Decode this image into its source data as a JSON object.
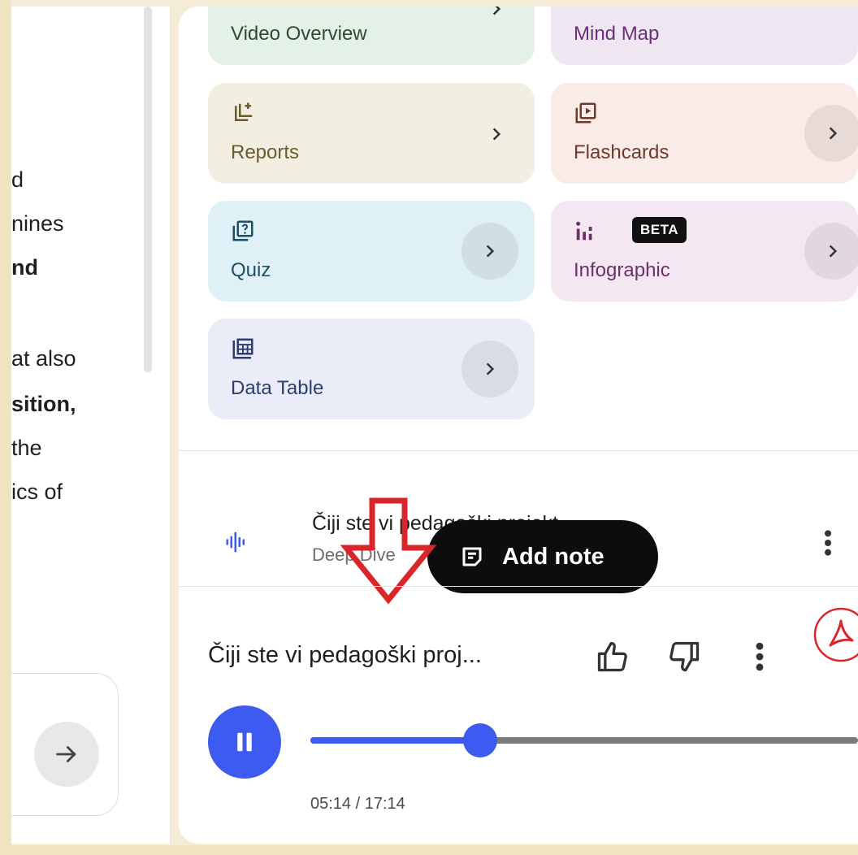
{
  "chat": {
    "lines": [
      "d",
      "nines",
      "nd",
      "at also",
      "sition,",
      "the",
      "ics of"
    ]
  },
  "studio": {
    "tiles": [
      {
        "label": "Video Overview",
        "icon": "video-icon",
        "color": "#e3f1e6",
        "text_color": "#2e4a35"
      },
      {
        "label": "Mind Map",
        "icon": "mind-map-icon",
        "color": "#eee7f1",
        "text_color": "#6b2f7a"
      },
      {
        "label": "Reports",
        "icon": "reports-icon",
        "color": "#f2efe2",
        "text_color": "#6a5b2d"
      },
      {
        "label": "Flashcards",
        "icon": "flashcards-icon",
        "color": "#f9ebe8",
        "text_color": "#6e3a2b"
      },
      {
        "label": "Quiz",
        "icon": "quiz-icon",
        "color": "#dff0f6",
        "text_color": "#1e4f66"
      },
      {
        "label": "Infographic",
        "icon": "infographic-icon",
        "color": "#f3e8f1",
        "text_color": "#6d2e6a",
        "badge": "BETA"
      },
      {
        "label": "Data Table",
        "icon": "data-table-icon",
        "color": "#eaedf8",
        "text_color": "#2d3d6e"
      }
    ]
  },
  "audio_item": {
    "title": "Čiji ste vi pedagoški projekt",
    "subtitle": "Deep Dive"
  },
  "tooltip": {
    "label": "Add note"
  },
  "player": {
    "title": "Čiji ste vi pedagoški proj...",
    "time": "05:14 / 17:14",
    "progress": 0.31
  },
  "colors": {
    "accent": "#3d5af1",
    "arrow": "#d9262b"
  }
}
